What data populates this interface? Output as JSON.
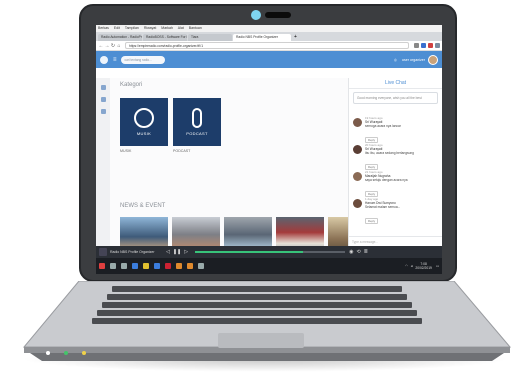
{
  "colors": {
    "accent": "#4d8ed3",
    "tile_bg": "#1d3d6a",
    "progress": "#38c37a"
  },
  "browser": {
    "menu": [
      "Berkas",
      "Edit",
      "Tampilan",
      "Riwayat",
      "Markah",
      "Alat",
      "Bantuan"
    ],
    "tabs": [
      "Radio Automation - RadioPro",
      "RadioBOSS - Software For Radio",
      "Tiara",
      "Radio NBS Profile Organizer"
    ],
    "url": "https://empireradio.com/radio-profile-organizer/#!/1"
  },
  "app": {
    "search_placeholder": "cari tentang radio...",
    "user_name": "user organizer"
  },
  "main": {
    "section_kategori": "Kategori",
    "tiles": [
      {
        "caption": "MUSIK",
        "label": "MUSIK"
      },
      {
        "caption": "PODCAST",
        "label": "PODCAST"
      }
    ],
    "section_news": "NEWS & EVENT"
  },
  "chat": {
    "title": "Live Chat",
    "new_message_placeholder": "Good morning everyone, wish you all the best",
    "messages": [
      {
        "time": "19 hours ago",
        "name": "Sri Wurayati",
        "body": "semoga acara nya lancar",
        "reply": "Reply"
      },
      {
        "time": "20 hours ago",
        "name": "Sri Wurayati",
        "body": "ibu ibu, acara sedang berlangsung",
        "reply": "Reply"
      },
      {
        "time": "21 hours ago",
        "name": "Maraijah Nugraha",
        "body": "saya setuju dengan acara nya",
        "reply": "Reply"
      },
      {
        "time": "1 day ago",
        "name": "Hanum Dwi Sumyono",
        "body": "Selamat malam semua...",
        "reply": "Reply"
      }
    ],
    "input_placeholder": "Type a message..."
  },
  "player": {
    "title": "Radio NBS Profile Organizer",
    "progress": 0.72
  },
  "taskbar": {
    "clock_time": "7:08",
    "clock_date": "20/02/2019"
  }
}
